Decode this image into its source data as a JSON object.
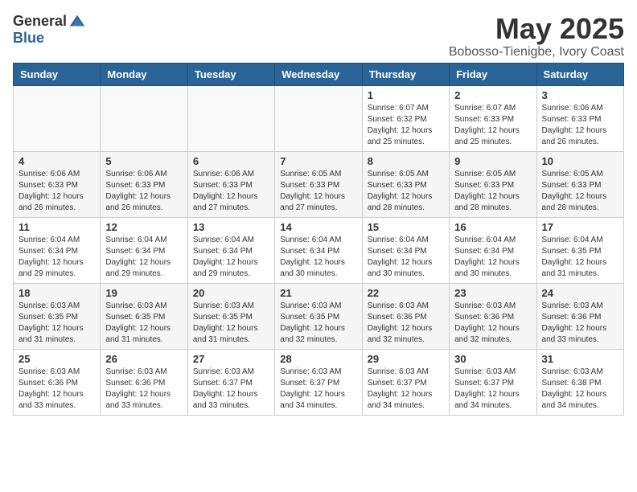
{
  "header": {
    "logo_general": "General",
    "logo_blue": "Blue",
    "month": "May 2025",
    "location": "Bobosso-Tienigbe, Ivory Coast"
  },
  "weekdays": [
    "Sunday",
    "Monday",
    "Tuesday",
    "Wednesday",
    "Thursday",
    "Friday",
    "Saturday"
  ],
  "weeks": [
    [
      {
        "day": "",
        "info": ""
      },
      {
        "day": "",
        "info": ""
      },
      {
        "day": "",
        "info": ""
      },
      {
        "day": "",
        "info": ""
      },
      {
        "day": "1",
        "info": "Sunrise: 6:07 AM\nSunset: 6:32 PM\nDaylight: 12 hours\nand 25 minutes."
      },
      {
        "day": "2",
        "info": "Sunrise: 6:07 AM\nSunset: 6:33 PM\nDaylight: 12 hours\nand 25 minutes."
      },
      {
        "day": "3",
        "info": "Sunrise: 6:06 AM\nSunset: 6:33 PM\nDaylight: 12 hours\nand 26 minutes."
      }
    ],
    [
      {
        "day": "4",
        "info": "Sunrise: 6:06 AM\nSunset: 6:33 PM\nDaylight: 12 hours\nand 26 minutes."
      },
      {
        "day": "5",
        "info": "Sunrise: 6:06 AM\nSunset: 6:33 PM\nDaylight: 12 hours\nand 26 minutes."
      },
      {
        "day": "6",
        "info": "Sunrise: 6:06 AM\nSunset: 6:33 PM\nDaylight: 12 hours\nand 27 minutes."
      },
      {
        "day": "7",
        "info": "Sunrise: 6:05 AM\nSunset: 6:33 PM\nDaylight: 12 hours\nand 27 minutes."
      },
      {
        "day": "8",
        "info": "Sunrise: 6:05 AM\nSunset: 6:33 PM\nDaylight: 12 hours\nand 28 minutes."
      },
      {
        "day": "9",
        "info": "Sunrise: 6:05 AM\nSunset: 6:33 PM\nDaylight: 12 hours\nand 28 minutes."
      },
      {
        "day": "10",
        "info": "Sunrise: 6:05 AM\nSunset: 6:33 PM\nDaylight: 12 hours\nand 28 minutes."
      }
    ],
    [
      {
        "day": "11",
        "info": "Sunrise: 6:04 AM\nSunset: 6:34 PM\nDaylight: 12 hours\nand 29 minutes."
      },
      {
        "day": "12",
        "info": "Sunrise: 6:04 AM\nSunset: 6:34 PM\nDaylight: 12 hours\nand 29 minutes."
      },
      {
        "day": "13",
        "info": "Sunrise: 6:04 AM\nSunset: 6:34 PM\nDaylight: 12 hours\nand 29 minutes."
      },
      {
        "day": "14",
        "info": "Sunrise: 6:04 AM\nSunset: 6:34 PM\nDaylight: 12 hours\nand 30 minutes."
      },
      {
        "day": "15",
        "info": "Sunrise: 6:04 AM\nSunset: 6:34 PM\nDaylight: 12 hours\nand 30 minutes."
      },
      {
        "day": "16",
        "info": "Sunrise: 6:04 AM\nSunset: 6:34 PM\nDaylight: 12 hours\nand 30 minutes."
      },
      {
        "day": "17",
        "info": "Sunrise: 6:04 AM\nSunset: 6:35 PM\nDaylight: 12 hours\nand 31 minutes."
      }
    ],
    [
      {
        "day": "18",
        "info": "Sunrise: 6:03 AM\nSunset: 6:35 PM\nDaylight: 12 hours\nand 31 minutes."
      },
      {
        "day": "19",
        "info": "Sunrise: 6:03 AM\nSunset: 6:35 PM\nDaylight: 12 hours\nand 31 minutes."
      },
      {
        "day": "20",
        "info": "Sunrise: 6:03 AM\nSunset: 6:35 PM\nDaylight: 12 hours\nand 31 minutes."
      },
      {
        "day": "21",
        "info": "Sunrise: 6:03 AM\nSunset: 6:35 PM\nDaylight: 12 hours\nand 32 minutes."
      },
      {
        "day": "22",
        "info": "Sunrise: 6:03 AM\nSunset: 6:36 PM\nDaylight: 12 hours\nand 32 minutes."
      },
      {
        "day": "23",
        "info": "Sunrise: 6:03 AM\nSunset: 6:36 PM\nDaylight: 12 hours\nand 32 minutes."
      },
      {
        "day": "24",
        "info": "Sunrise: 6:03 AM\nSunset: 6:36 PM\nDaylight: 12 hours\nand 33 minutes."
      }
    ],
    [
      {
        "day": "25",
        "info": "Sunrise: 6:03 AM\nSunset: 6:36 PM\nDaylight: 12 hours\nand 33 minutes."
      },
      {
        "day": "26",
        "info": "Sunrise: 6:03 AM\nSunset: 6:36 PM\nDaylight: 12 hours\nand 33 minutes."
      },
      {
        "day": "27",
        "info": "Sunrise: 6:03 AM\nSunset: 6:37 PM\nDaylight: 12 hours\nand 33 minutes."
      },
      {
        "day": "28",
        "info": "Sunrise: 6:03 AM\nSunset: 6:37 PM\nDaylight: 12 hours\nand 34 minutes."
      },
      {
        "day": "29",
        "info": "Sunrise: 6:03 AM\nSunset: 6:37 PM\nDaylight: 12 hours\nand 34 minutes."
      },
      {
        "day": "30",
        "info": "Sunrise: 6:03 AM\nSunset: 6:37 PM\nDaylight: 12 hours\nand 34 minutes."
      },
      {
        "day": "31",
        "info": "Sunrise: 6:03 AM\nSunset: 6:38 PM\nDaylight: 12 hours\nand 34 minutes."
      }
    ]
  ]
}
